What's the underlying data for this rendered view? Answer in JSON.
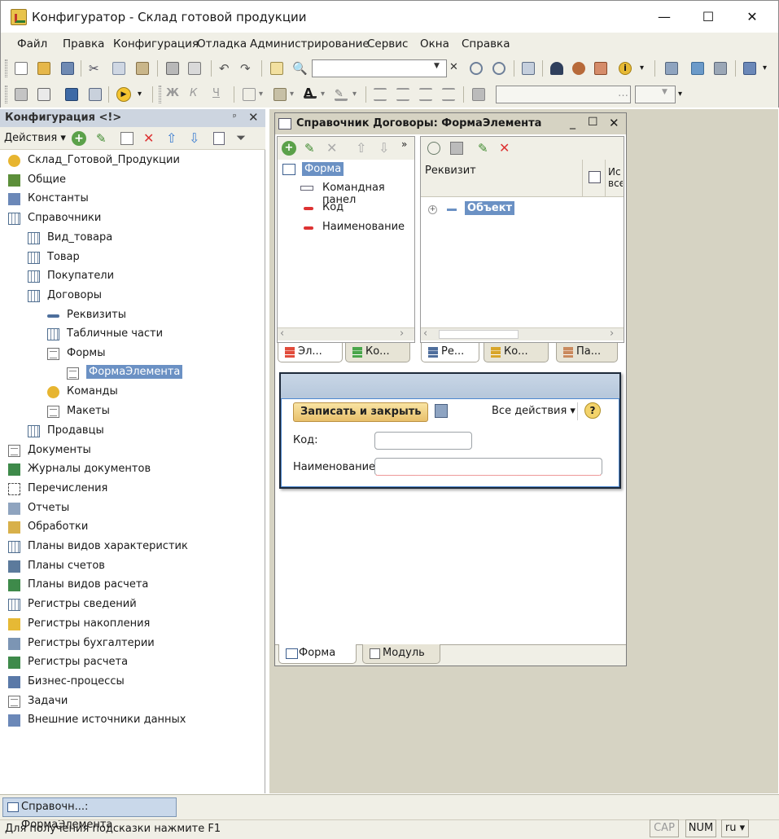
{
  "window": {
    "title": "Конфигуратор - Склад готовой продукции",
    "minimize": "—",
    "maximize": "☐",
    "close": "✕"
  },
  "menu": [
    "Файл",
    "Правка",
    "Конфигурация",
    "Отладка",
    "Администрирование",
    "Сервис",
    "Окна",
    "Справка"
  ],
  "config_panel": {
    "title": "Конфигурация <!>",
    "actions_label": "Действия ▾",
    "tree": [
      {
        "label": "Склад_Готовой_Продукции",
        "icon": "root-icon"
      },
      {
        "label": "Общие",
        "icon": "common-icon"
      },
      {
        "label": "Константы",
        "icon": "constants-icon"
      },
      {
        "label": "Справочники",
        "icon": "catalog-icon"
      },
      {
        "label": "Вид_товара",
        "icon": "catalog-icon"
      },
      {
        "label": "Товар",
        "icon": "catalog-icon"
      },
      {
        "label": "Покупатели",
        "icon": "catalog-icon"
      },
      {
        "label": "Договоры",
        "icon": "catalog-icon"
      },
      {
        "label": "Реквизиты",
        "icon": "attribute-icon"
      },
      {
        "label": "Табличные части",
        "icon": "tabular-icon"
      },
      {
        "label": "Формы",
        "icon": "form-icon"
      },
      {
        "label": "ФормаЭлемента",
        "icon": "form-icon",
        "selected": true
      },
      {
        "label": "Команды",
        "icon": "command-icon"
      },
      {
        "label": "Макеты",
        "icon": "template-icon"
      },
      {
        "label": "Продавцы",
        "icon": "catalog-icon"
      },
      {
        "label": "Документы",
        "icon": "document-icon"
      },
      {
        "label": "Журналы документов",
        "icon": "journal-icon"
      },
      {
        "label": "Перечисления",
        "icon": "enum-icon"
      },
      {
        "label": "Отчеты",
        "icon": "report-icon"
      },
      {
        "label": "Обработки",
        "icon": "processing-icon"
      },
      {
        "label": "Планы видов характеристик",
        "icon": "chart-char-icon"
      },
      {
        "label": "Планы счетов",
        "icon": "chart-accounts-icon"
      },
      {
        "label": "Планы видов расчета",
        "icon": "chart-calc-icon"
      },
      {
        "label": "Регистры сведений",
        "icon": "info-register-icon"
      },
      {
        "label": "Регистры накопления",
        "icon": "accum-register-icon"
      },
      {
        "label": "Регистры бухгалтерии",
        "icon": "account-register-icon"
      },
      {
        "label": "Регистры расчета",
        "icon": "calc-register-icon"
      },
      {
        "label": "Бизнес-процессы",
        "icon": "bp-icon"
      },
      {
        "label": "Задачи",
        "icon": "task-icon"
      },
      {
        "label": "Внешние источники данных",
        "icon": "ext-source-icon"
      }
    ]
  },
  "form_window": {
    "title": "Справочник Договоры: ФормаЭлемента",
    "elements": [
      "Форма",
      "Командная панел",
      "Код",
      "Наименование"
    ],
    "details_header": {
      "col1": "Реквизит",
      "col2": "Ис все"
    },
    "details_row": "Объект",
    "left_tabs": [
      "Эл...",
      "Ко..."
    ],
    "right_tabs": [
      "Ре...",
      "Ко...",
      "Па..."
    ],
    "bottom_tabs": [
      "Форма",
      "Модуль"
    ],
    "preview": {
      "save_close": "Записать и закрыть",
      "all_actions": "Все действия ▾",
      "help": "?",
      "code_label": "Код:",
      "name_label": "Наименование:"
    }
  },
  "status": {
    "task": "Справочн...: ФормаЭлемента",
    "hint": "Для получения подсказки нажмите F1",
    "cap": "CAP",
    "num": "NUM",
    "lang": "ru ▾"
  }
}
